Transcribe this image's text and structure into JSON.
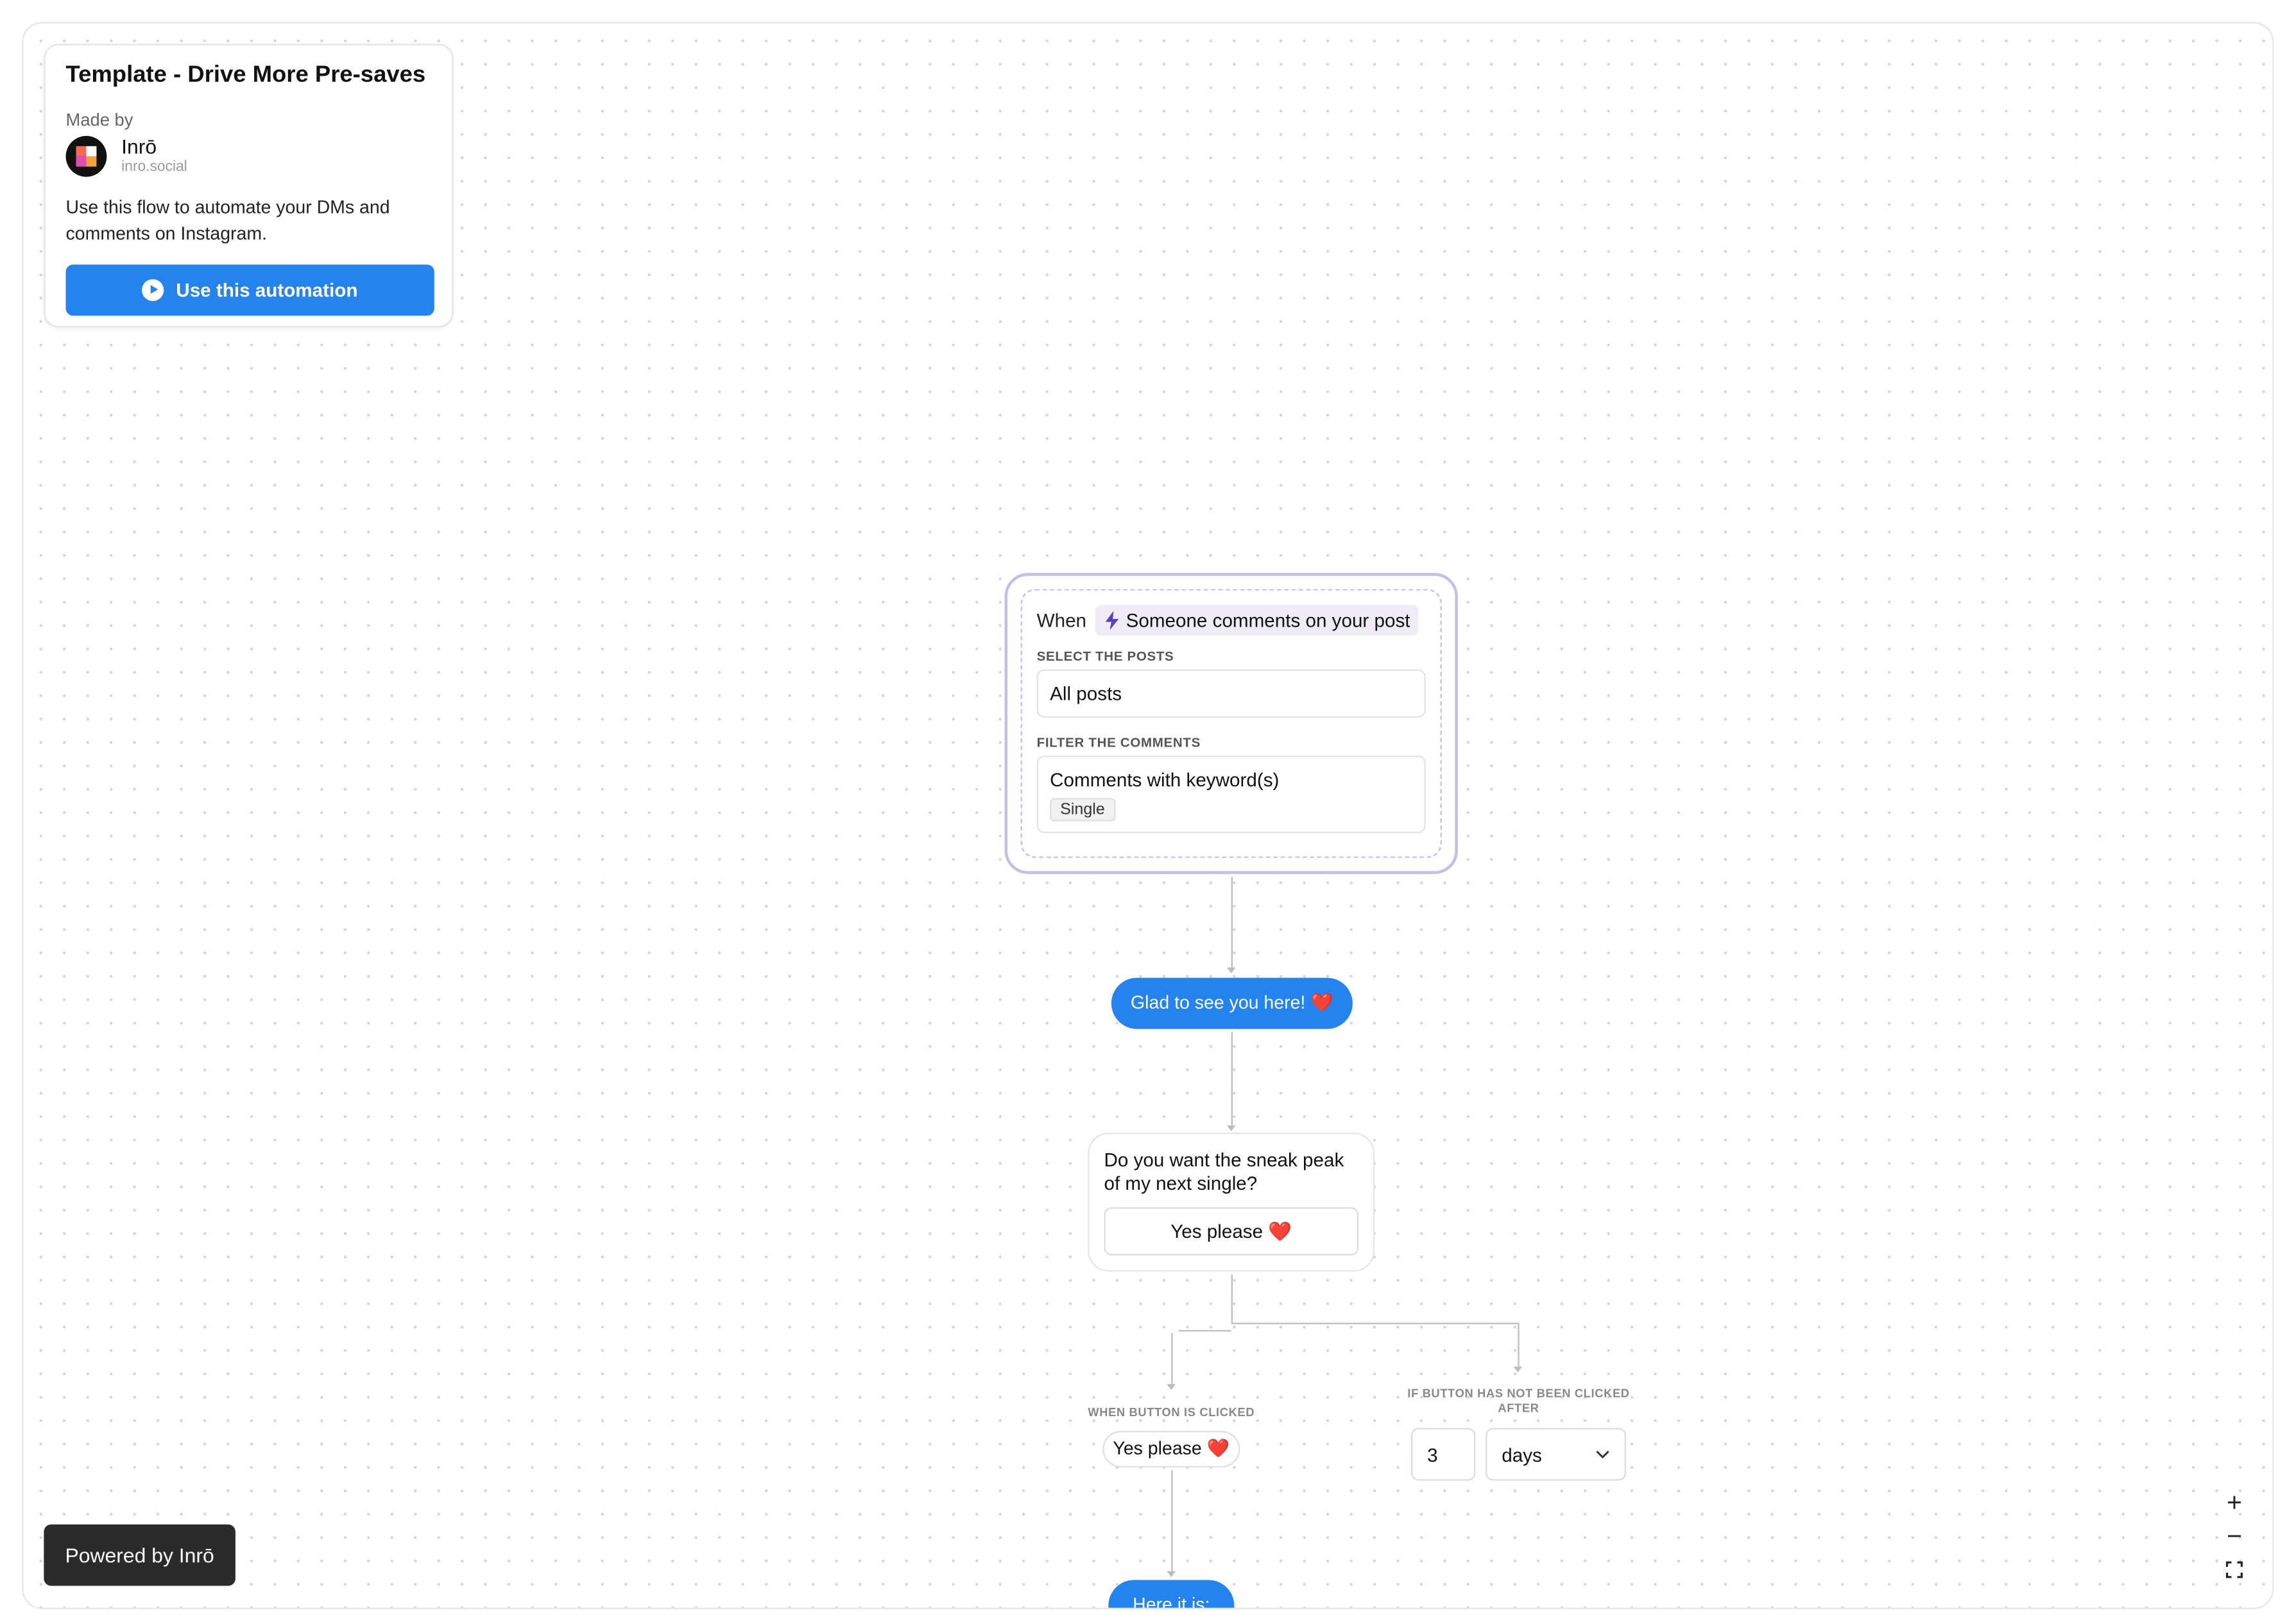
{
  "template": {
    "title": "Template - Drive More Pre-saves",
    "made_by_label": "Made by",
    "author_name": "Inrō",
    "author_domain": "inro.social",
    "description": "Use this flow to automate your DMs and comments on Instagram.",
    "use_button_label": "Use this automation"
  },
  "trigger": {
    "when_label": "When",
    "event_label": "Someone comments on your post",
    "select_posts_label": "SELECT THE POSTS",
    "select_posts_value": "All posts",
    "filter_label": "FILTER THE COMMENTS",
    "filter_value": "Comments with keyword(s)",
    "filter_tag": "Single"
  },
  "flow": {
    "greeting_message": "Glad to see you here! ❤️",
    "question_text": "Do you want the sneak peak of my next single?",
    "question_button_label": "Yes please ❤️",
    "branch_clicked_label": "WHEN BUTTON IS CLICKED",
    "branch_clicked_value": "Yes please ❤️",
    "branch_not_clicked_label": "IF BUTTON HAS NOT BEEN CLICKED AFTER",
    "delay_value": "3",
    "delay_unit": "days",
    "next_message": "Here it is:"
  },
  "footer": {
    "powered_by": "Powered by Inrō"
  },
  "zoom": {
    "zoom_in": "+",
    "zoom_out": "−"
  },
  "icons": {
    "trigger": "bolt-icon",
    "use_button": "play-icon",
    "select": "chevron-down-icon",
    "fit_view": "fullscreen-icon"
  },
  "colors": {
    "accent_blue": "#2583f0",
    "trigger_border": "#c7bde6",
    "trigger_pill_bg": "#efecf7",
    "bolt": "#5b3fc4",
    "powered_bg": "#2b2b2b"
  }
}
